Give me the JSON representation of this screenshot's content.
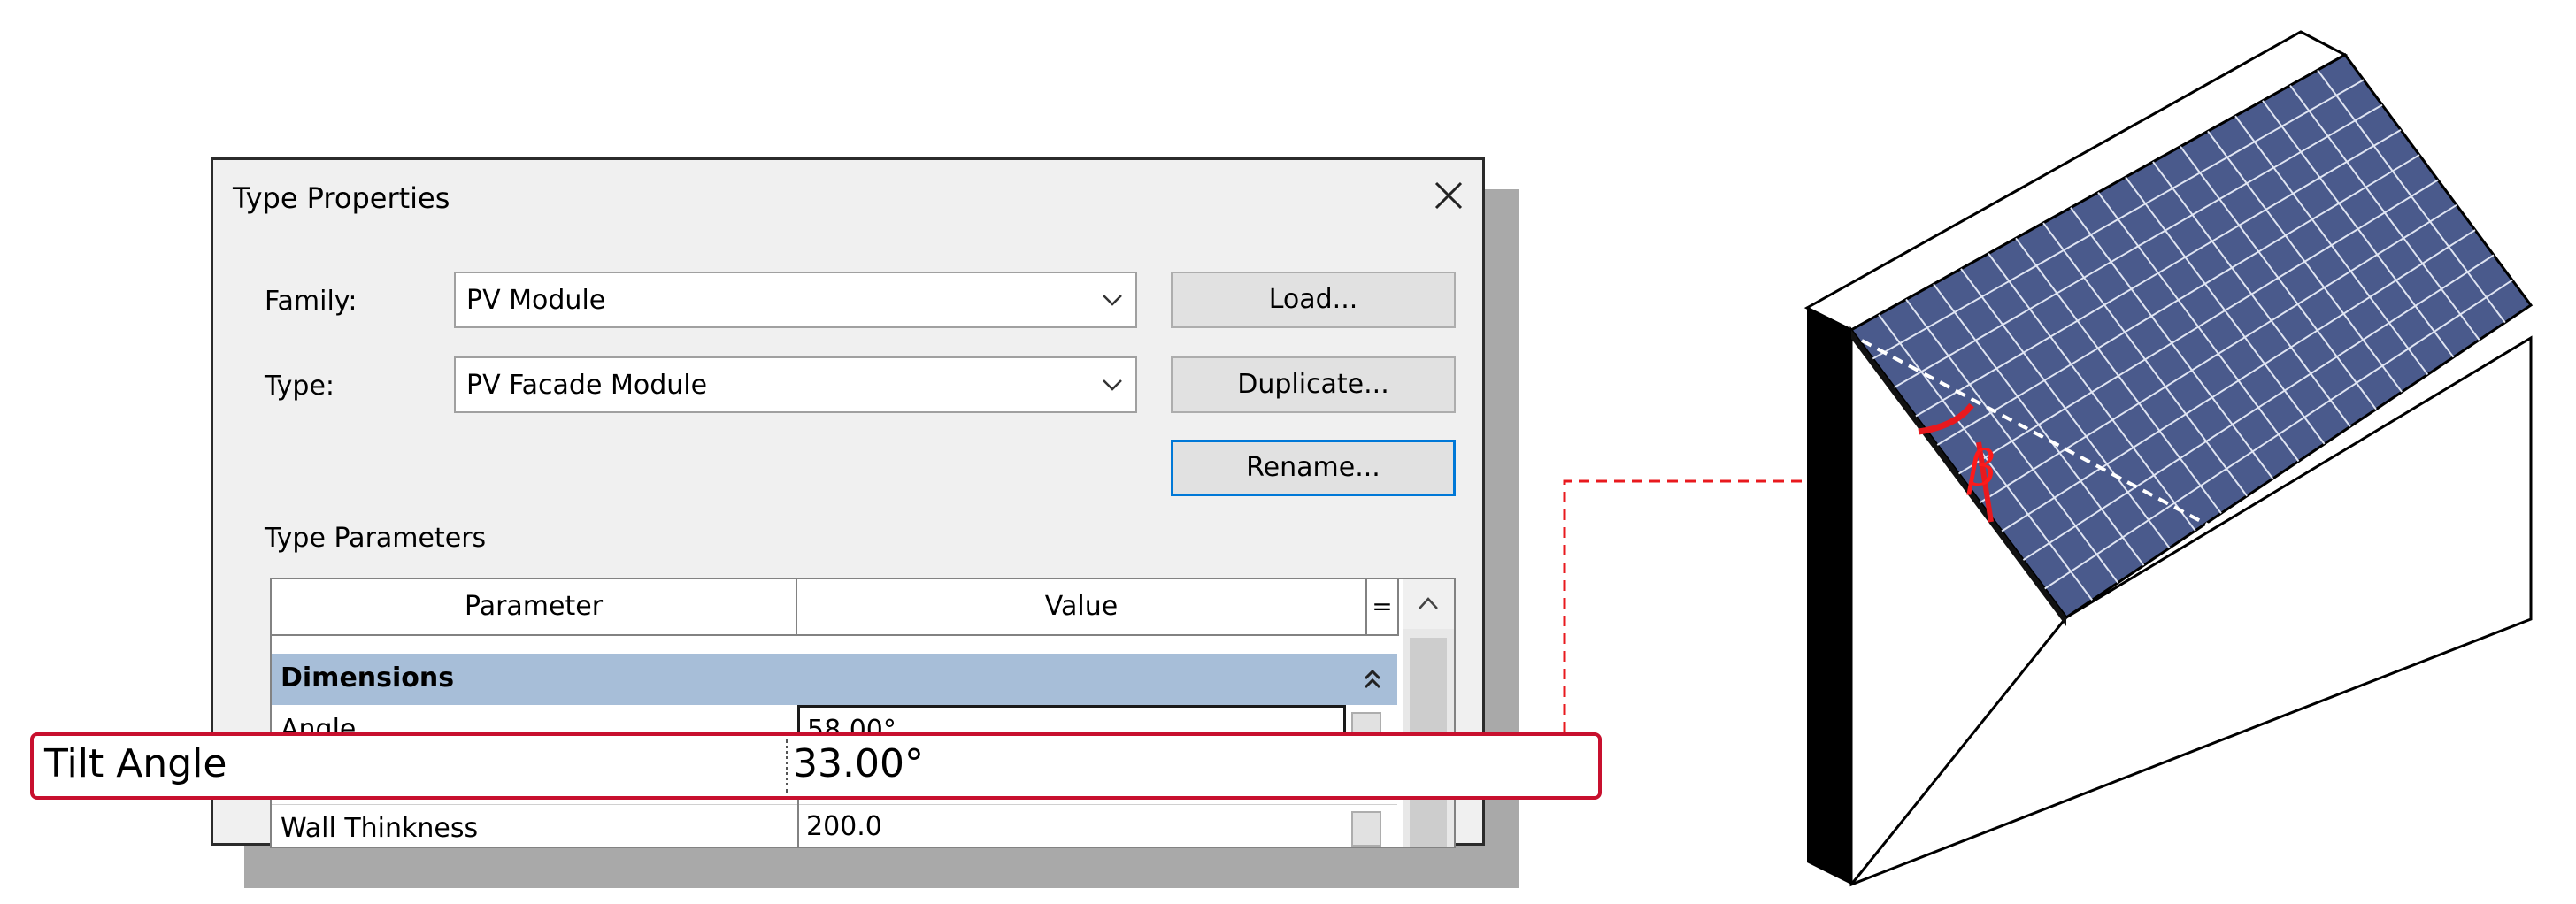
{
  "dialog": {
    "title": "Type Properties",
    "family_label": "Family:",
    "family_value": "PV Module",
    "type_label": "Type:",
    "type_value": "PV Facade Module",
    "load_label": "Load...",
    "duplicate_label": "Duplicate...",
    "rename_label": "Rename...",
    "type_parameters_label": "Type Parameters"
  },
  "grid": {
    "columns": [
      "Parameter",
      "Value",
      "="
    ],
    "group": "Dimensions",
    "rows": [
      {
        "name": "Angle",
        "value": "58.00°"
      },
      {
        "name": "",
        "value": ""
      },
      {
        "name": "Wall Thinkness",
        "value": "200.0"
      }
    ]
  },
  "callout": {
    "label": "Tilt Angle",
    "value": "33.00°"
  },
  "illustration": {
    "angle_symbol": "β",
    "panel_color": "#4a5a8c",
    "accent_color": "#e8191e"
  }
}
